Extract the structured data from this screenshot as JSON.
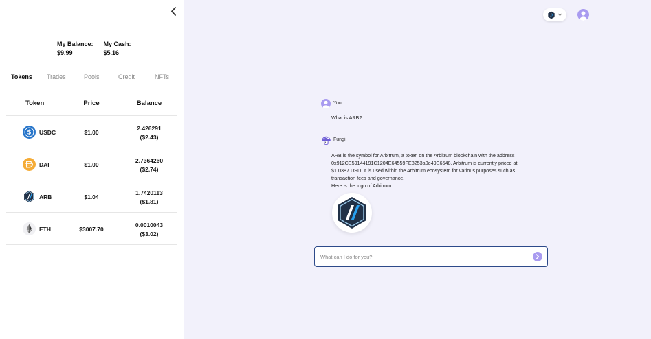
{
  "sidebar": {
    "balance_label": "My Balance:",
    "balance_value": "$9.99",
    "cash_label": "My Cash:",
    "cash_value": "$5.16",
    "tabs": [
      {
        "label": "Tokens",
        "active": true
      },
      {
        "label": "Trades",
        "active": false
      },
      {
        "label": "Pools",
        "active": false
      },
      {
        "label": "Credit",
        "active": false
      },
      {
        "label": "NFTs",
        "active": false
      }
    ],
    "table": {
      "headers": [
        "Token",
        "Price",
        "Balance"
      ],
      "rows": [
        {
          "icon": "usdc-icon",
          "symbol": "USDC",
          "price": "$1.00",
          "balance": "2.426291",
          "balance_usd": "($2.43)"
        },
        {
          "icon": "dai-icon",
          "symbol": "DAI",
          "price": "$1.00",
          "balance": "2.7364260",
          "balance_usd": "($2.74)"
        },
        {
          "icon": "arb-icon",
          "symbol": "ARB",
          "price": "$1.04",
          "balance": "1.7420113",
          "balance_usd": "($1.81)"
        },
        {
          "icon": "eth-icon",
          "symbol": "ETH",
          "price": "$3007.70",
          "balance": "0.0010043",
          "balance_usd": "($3.02)"
        }
      ]
    }
  },
  "chat": {
    "user_name": "You",
    "user_message": "What is ARB?",
    "bot_name": "Fungi",
    "bot_lines": [
      "ARB is the symbol for Arbitrum, a token on the Arbitrum blockchain with the address",
      "0x912CE59144191C1204E64559FE8253a0e49E6548. Arbitrum is currently priced at",
      "$1.0387 USD. It is used within the Arbitrum ecosystem for various purposes such as",
      "transaction fees and governance.",
      "Here is the logo of Arbitrum:"
    ],
    "input_placeholder": "What can I do for you?",
    "input_value": ""
  },
  "colors": {
    "accent": "#a99bf0",
    "input_border": "#2d4a8a",
    "background": "#f2f1fb",
    "usdc": "#2775ca",
    "dai": "#f5ac37",
    "arb": "#213147"
  }
}
